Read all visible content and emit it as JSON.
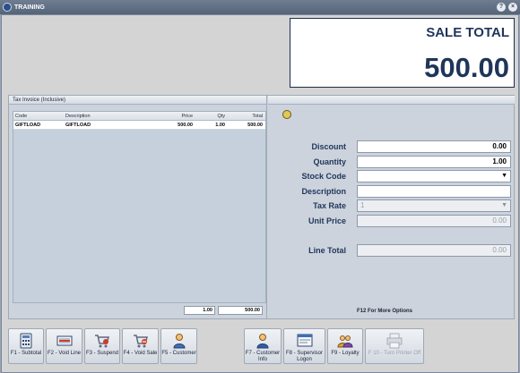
{
  "window": {
    "title": "TRAINING",
    "help_glyph": "?",
    "close_glyph": "×"
  },
  "sale": {
    "label": "SALE TOTAL",
    "value": "500.00"
  },
  "invoice": {
    "header": "Tax Invoice (Inclusive)",
    "columns": [
      "Code",
      "Description",
      "Price",
      "Qty",
      "Total"
    ],
    "rows": [
      {
        "code": "GIFTLOAD",
        "description": "GIFTLOAD",
        "price": "500.00",
        "qty": "1.00",
        "total": "500.00"
      }
    ],
    "total_qty": "1.00",
    "total_amount": "500.00"
  },
  "form": {
    "discount_label": "Discount",
    "discount_value": "0.00",
    "quantity_label": "Quantity",
    "quantity_value": "1.00",
    "stock_code_label": "Stock Code",
    "stock_code_value": "",
    "description_label": "Description",
    "description_value": "",
    "tax_rate_label": "Tax Rate",
    "tax_rate_value": "1",
    "unit_price_label": "Unit Price",
    "unit_price_value": "0.00",
    "line_total_label": "Line Total",
    "line_total_value": "0.00",
    "more_options": "F12 For More Options"
  },
  "toolbar": {
    "f1": "F1 - Subtotal",
    "f2": "F2 - Void Line",
    "f3": "F3 - Suspend",
    "f4": "F4 - Void Sale",
    "f5": "F5 - Customer",
    "f7": "F7 - Customer Info",
    "f8": "F8 - Supervisor Logon",
    "f9": "F9 - Loyalty",
    "f10": "F 10 - Turn Printer Off"
  }
}
